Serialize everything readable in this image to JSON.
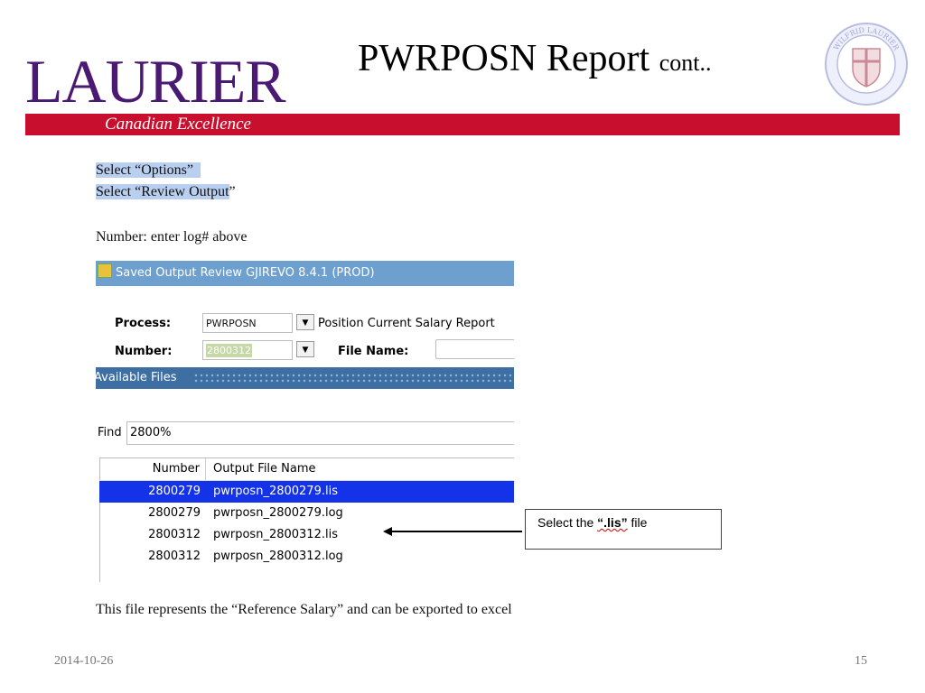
{
  "header": {
    "logo_text": "LAURIER",
    "tagline": "Canadian Excellence",
    "title_main": "PWRPOSN Report",
    "title_suffix": "cont..",
    "seal_text": "WILFRID LAURIER UNIVERSITY"
  },
  "instructions": {
    "line1": "Select “Options”",
    "line2a": "Select “Review Output",
    "line2b": "”",
    "number_note": "Number:  enter log# above"
  },
  "form": {
    "window_title": "Saved Output Review  GJIREVO  8.4.1  (PROD)",
    "process_label": "Process:",
    "process_value": "PWRPOSN",
    "process_desc": "Position Current Salary Report",
    "number_label": "Number:",
    "number_value": "2800312",
    "file_name_label": "File Name:",
    "file_name_value": "",
    "section_label": "Available Files",
    "find_label": "Find",
    "find_value": "2800%",
    "columns": [
      "Number",
      "Output File Name"
    ],
    "rows": [
      {
        "number": "2800279",
        "file": "pwrposn_2800279.lis",
        "selected": true
      },
      {
        "number": "2800279",
        "file": "pwrposn_2800279.log",
        "selected": false
      },
      {
        "number": "2800312",
        "file": "pwrposn_2800312.lis",
        "selected": false
      },
      {
        "number": "2800312",
        "file": "pwrposn_2800312.log",
        "selected": false
      }
    ]
  },
  "callout": {
    "prefix": "Select the ",
    "bold": "“.lis”",
    "suffix": " file"
  },
  "note": "This file represents the “Reference Salary” and can be exported to excel",
  "footer": {
    "date": "2014-10-26",
    "page": "15"
  },
  "colors": {
    "brand_purple": "#4a1a73",
    "brand_red": "#c8102e",
    "selection_blue": "#1432e8"
  }
}
